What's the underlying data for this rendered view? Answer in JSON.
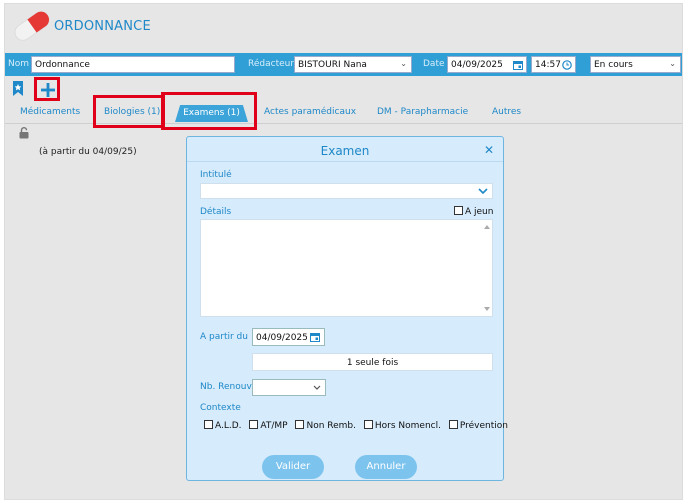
{
  "header": {
    "title": "ORDONNANCE"
  },
  "bar": {
    "nom_label": "Nom",
    "nom_value": "Ordonnance",
    "redacteur_label": "Rédacteur",
    "redacteur_value": "BISTOURI Nana",
    "date_label": "Date",
    "date_value": "04/09/2025",
    "time_value": "14:57",
    "status_value": "En cours"
  },
  "tabs": [
    {
      "label": "Médicaments"
    },
    {
      "label": "Biologies (1)"
    },
    {
      "label": "Examens (1)"
    },
    {
      "label": "Actes paramédicaux"
    },
    {
      "label": "DM - Parapharmacie"
    },
    {
      "label": "Autres"
    }
  ],
  "content": {
    "from_text": "(à partir du 04/09/25)"
  },
  "dialog": {
    "title": "Examen",
    "intitule_label": "Intitulé",
    "intitule_value": "",
    "details_label": "Détails",
    "details_value": "",
    "a_jeun_label": "A jeun",
    "a_partir_label": "A partir du",
    "a_partir_value": "04/09/2025",
    "frequency_value": "1 seule fois",
    "renouv_label": "Nb. Renouv.",
    "renouv_value": "",
    "contexte_label": "Contexte",
    "contexte_options": [
      "A.L.D.",
      "AT/MP",
      "Non Remb.",
      "Hors Nomencl.",
      "Prévention"
    ],
    "valider_label": "Valider",
    "annuler_label": "Annuler"
  },
  "colors": {
    "accent": "#1e88c8",
    "bar": "#2f9fd6",
    "highlight": "#e0001a",
    "dialog_bg": "#d6ebfb"
  }
}
